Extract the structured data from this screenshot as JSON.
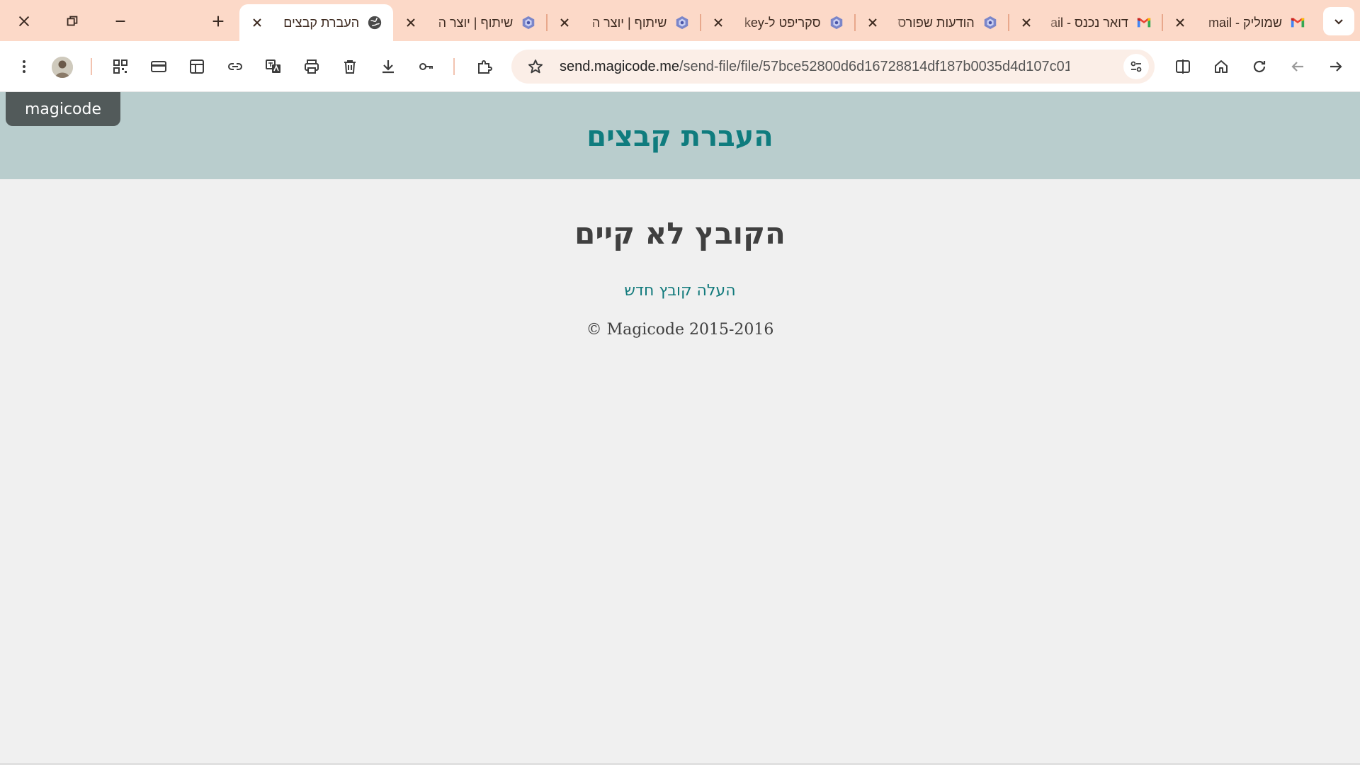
{
  "browser": {
    "tabs": [
      {
        "title": "העברת קבצים",
        "favicon": "globe-icon",
        "active": true
      },
      {
        "title": "שיתוף | יוצר ה",
        "favicon": "extension-icon",
        "active": false
      },
      {
        "title": "שיתוף | יוצר ה",
        "favicon": "extension-icon",
        "active": false
      },
      {
        "title": "סקריפט ל-key",
        "favicon": "extension-icon",
        "active": false
      },
      {
        "title": "הודעות שפורס",
        "favicon": "extension-icon",
        "active": false
      },
      {
        "title": "דואר נכנס - ail",
        "favicon": "gmail-icon",
        "active": false
      },
      {
        "title": "שמוליק - mail",
        "favicon": "gmail-icon",
        "active": false
      }
    ],
    "address_bar": {
      "host": "send.magicode.me",
      "path": "/send-file/file/57bce52800d6d16728814df187b0035d4d107c01/..."
    }
  },
  "page": {
    "brand": "magicode",
    "site_title": "העברת קבצים",
    "message": "הקובץ לא קיים",
    "upload_link": "העלה קובץ חדש",
    "copyright": "© Magicode 2015-2016"
  },
  "colors": {
    "tabstrip_bg": "#fcd9c8",
    "header_bg": "#b9cdcd",
    "accent_teal": "#0f7c7e",
    "brand_badge": "#525a5a",
    "page_bg": "#f0f0f0"
  }
}
